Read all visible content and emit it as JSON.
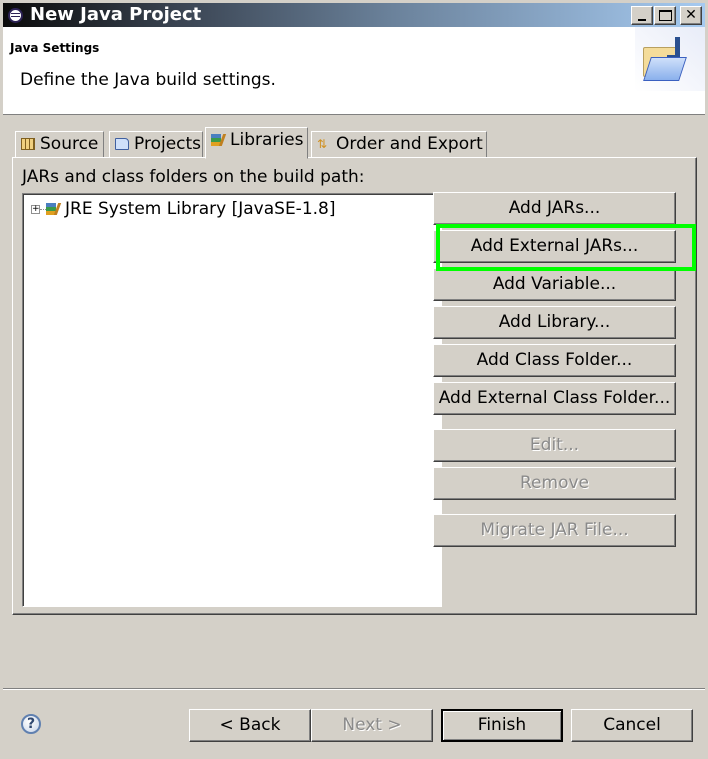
{
  "window": {
    "title": "New Java Project",
    "controls": {
      "minimize": "minimize",
      "maximize": "maximize",
      "close": "✕"
    }
  },
  "header": {
    "section_title": "Java Settings",
    "description": "Define the Java build settings.",
    "banner_icon": "java-folder-icon"
  },
  "tabs": [
    {
      "label": "Source",
      "icon": "source-folder-icon",
      "active": false
    },
    {
      "label": "Projects",
      "icon": "project-folder-icon",
      "active": false
    },
    {
      "label": "Libraries",
      "icon": "library-icon",
      "active": true
    },
    {
      "label": "Order and Export",
      "icon": "order-export-icon",
      "active": false
    }
  ],
  "libraries_panel": {
    "label": "JARs and class folders on the build path:",
    "tree_items": [
      {
        "label": "JRE System Library [JavaSE-1.8]",
        "expander": "⊞",
        "icon": "library-icon"
      }
    ],
    "buttons": [
      {
        "label": "Add JARs...",
        "enabled": true
      },
      {
        "label": "Add External JARs...",
        "enabled": true,
        "highlighted": true,
        "highlight_color": "#00ff00"
      },
      {
        "label": "Add Variable...",
        "enabled": true
      },
      {
        "label": "Add Library...",
        "enabled": true
      },
      {
        "label": "Add Class Folder...",
        "enabled": true
      },
      {
        "label": "Add External Class Folder...",
        "enabled": true
      },
      {
        "label": "Edit...",
        "enabled": false
      },
      {
        "label": "Remove",
        "enabled": false
      },
      {
        "label": "Migrate JAR File...",
        "enabled": false
      }
    ]
  },
  "footer": {
    "help_icon": "?",
    "back_label": "< Back",
    "next_label": "Next >",
    "finish_label": "Finish",
    "cancel_label": "Cancel"
  }
}
